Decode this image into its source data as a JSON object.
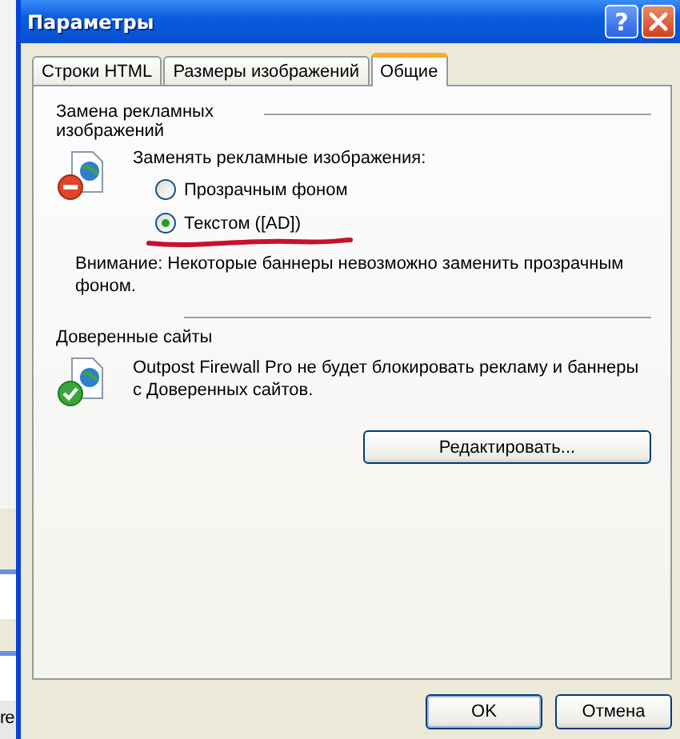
{
  "window": {
    "title": "Параметры",
    "help": "?"
  },
  "tabs": [
    {
      "label": "Строки HTML",
      "selected": false
    },
    {
      "label": "Размеры изображений",
      "selected": false
    },
    {
      "label": "Общие",
      "selected": true
    }
  ],
  "ad_replacement": {
    "title": "Замена рекламных изображений",
    "prompt": "Заменять рекламные изображения:",
    "options": [
      {
        "label": "Прозрачным фоном",
        "selected": false
      },
      {
        "label": "Текстом ([AD])",
        "selected": true
      }
    ],
    "note": "Внимание: Некоторые баннеры невозможно заменить прозрачным фоном."
  },
  "trusted_sites": {
    "title": "Доверенные сайты",
    "description": "Outpost Firewall Pro не будет блокировать рекламу и баннеры с Доверенных сайтов.",
    "button": "Редактировать..."
  },
  "buttons": [
    "OK",
    "Отмена"
  ],
  "background": {
    "text": "re"
  }
}
